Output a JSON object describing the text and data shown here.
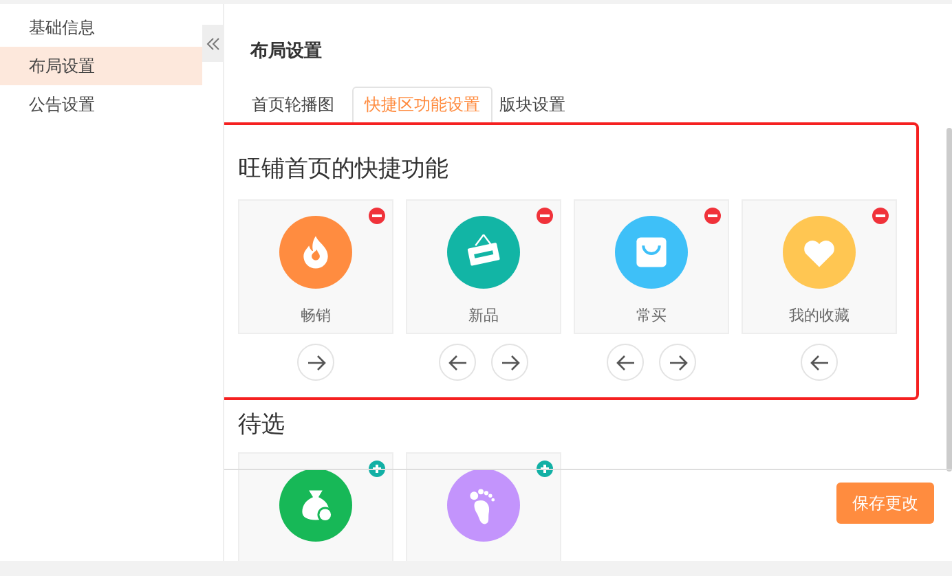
{
  "sidebar": {
    "items": [
      {
        "label": "基础信息",
        "selected": false
      },
      {
        "label": "布局设置",
        "selected": true
      },
      {
        "label": "公告设置",
        "selected": false
      }
    ]
  },
  "page_title": "布局设置",
  "tabs": [
    {
      "label": "首页轮播图",
      "selected": false
    },
    {
      "label": "快捷区功能设置",
      "selected": true
    },
    {
      "label": "版块设置",
      "selected": false
    }
  ],
  "quick_functions": {
    "title": "旺铺首页的快捷功能",
    "items": [
      {
        "label": "畅销",
        "kind": "flame",
        "color": "#ff8c40",
        "can_move_left": false,
        "can_move_right": true
      },
      {
        "label": "新品",
        "kind": "new-sign",
        "color": "#12b5a5",
        "can_move_left": true,
        "can_move_right": true
      },
      {
        "label": "常买",
        "kind": "bag",
        "color": "#3ec0f8",
        "can_move_left": true,
        "can_move_right": true
      },
      {
        "label": "我的收藏",
        "kind": "heart",
        "color": "#ffc652",
        "can_move_left": true,
        "can_move_right": false
      }
    ]
  },
  "pending": {
    "title": "待选",
    "items": [
      {
        "kind": "money-bag",
        "color": "#17b857"
      },
      {
        "kind": "footprint",
        "color": "#c394fc"
      }
    ]
  },
  "save_button": "保存更改"
}
